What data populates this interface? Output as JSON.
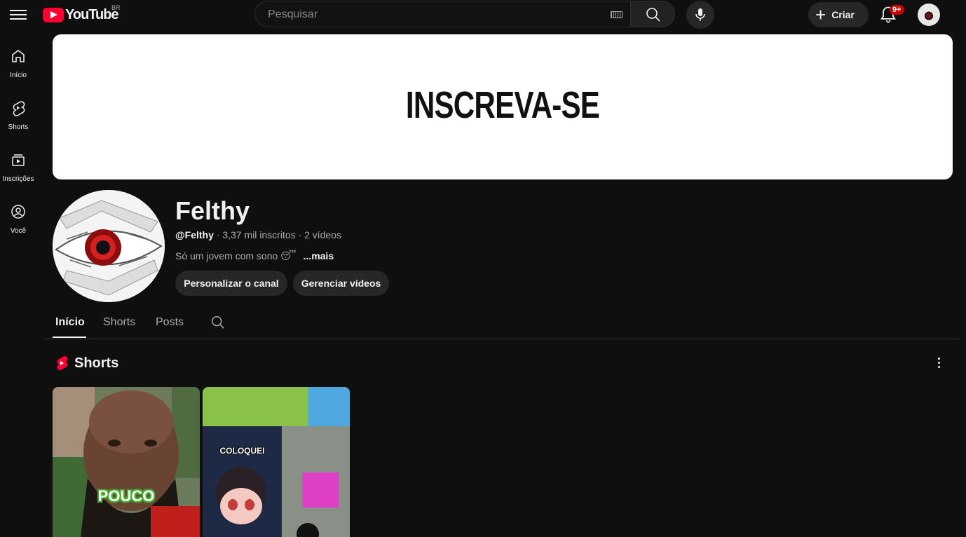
{
  "header": {
    "logo_text": "YouTube",
    "country_code": "BR",
    "search_placeholder": "Pesquisar",
    "create_label": "Criar",
    "notifications_badge": "9+"
  },
  "sidebar": {
    "items": [
      {
        "label": "Início",
        "icon": "home-icon"
      },
      {
        "label": "Shorts",
        "icon": "shorts-icon"
      },
      {
        "label": "Inscrições",
        "icon": "subscriptions-icon"
      },
      {
        "label": "Você",
        "icon": "you-icon"
      }
    ]
  },
  "banner": {
    "text": "INSCREVA-SE"
  },
  "channel": {
    "name": "Felthy",
    "handle": "@Felthy",
    "subscribers": "3,37 mil inscritos",
    "videos": "2 vídeos",
    "separator": "·",
    "description": "Só um jovem com sono 😴",
    "more_label": "...mais",
    "customize_label": "Personalizar o canal",
    "manage_label": "Gerenciar vídeos"
  },
  "tabs": [
    {
      "label": "Início",
      "active": true
    },
    {
      "label": "Shorts",
      "active": false
    },
    {
      "label": "Posts",
      "active": false
    }
  ],
  "shorts_shelf": {
    "title": "Shorts",
    "items": [
      {
        "overlay_text": "POUCO"
      },
      {
        "overlay_text": "COLOQUEI"
      }
    ]
  },
  "colors": {
    "background": "#0f0f0f",
    "brand_red": "#ff0033",
    "pill": "#272727"
  }
}
